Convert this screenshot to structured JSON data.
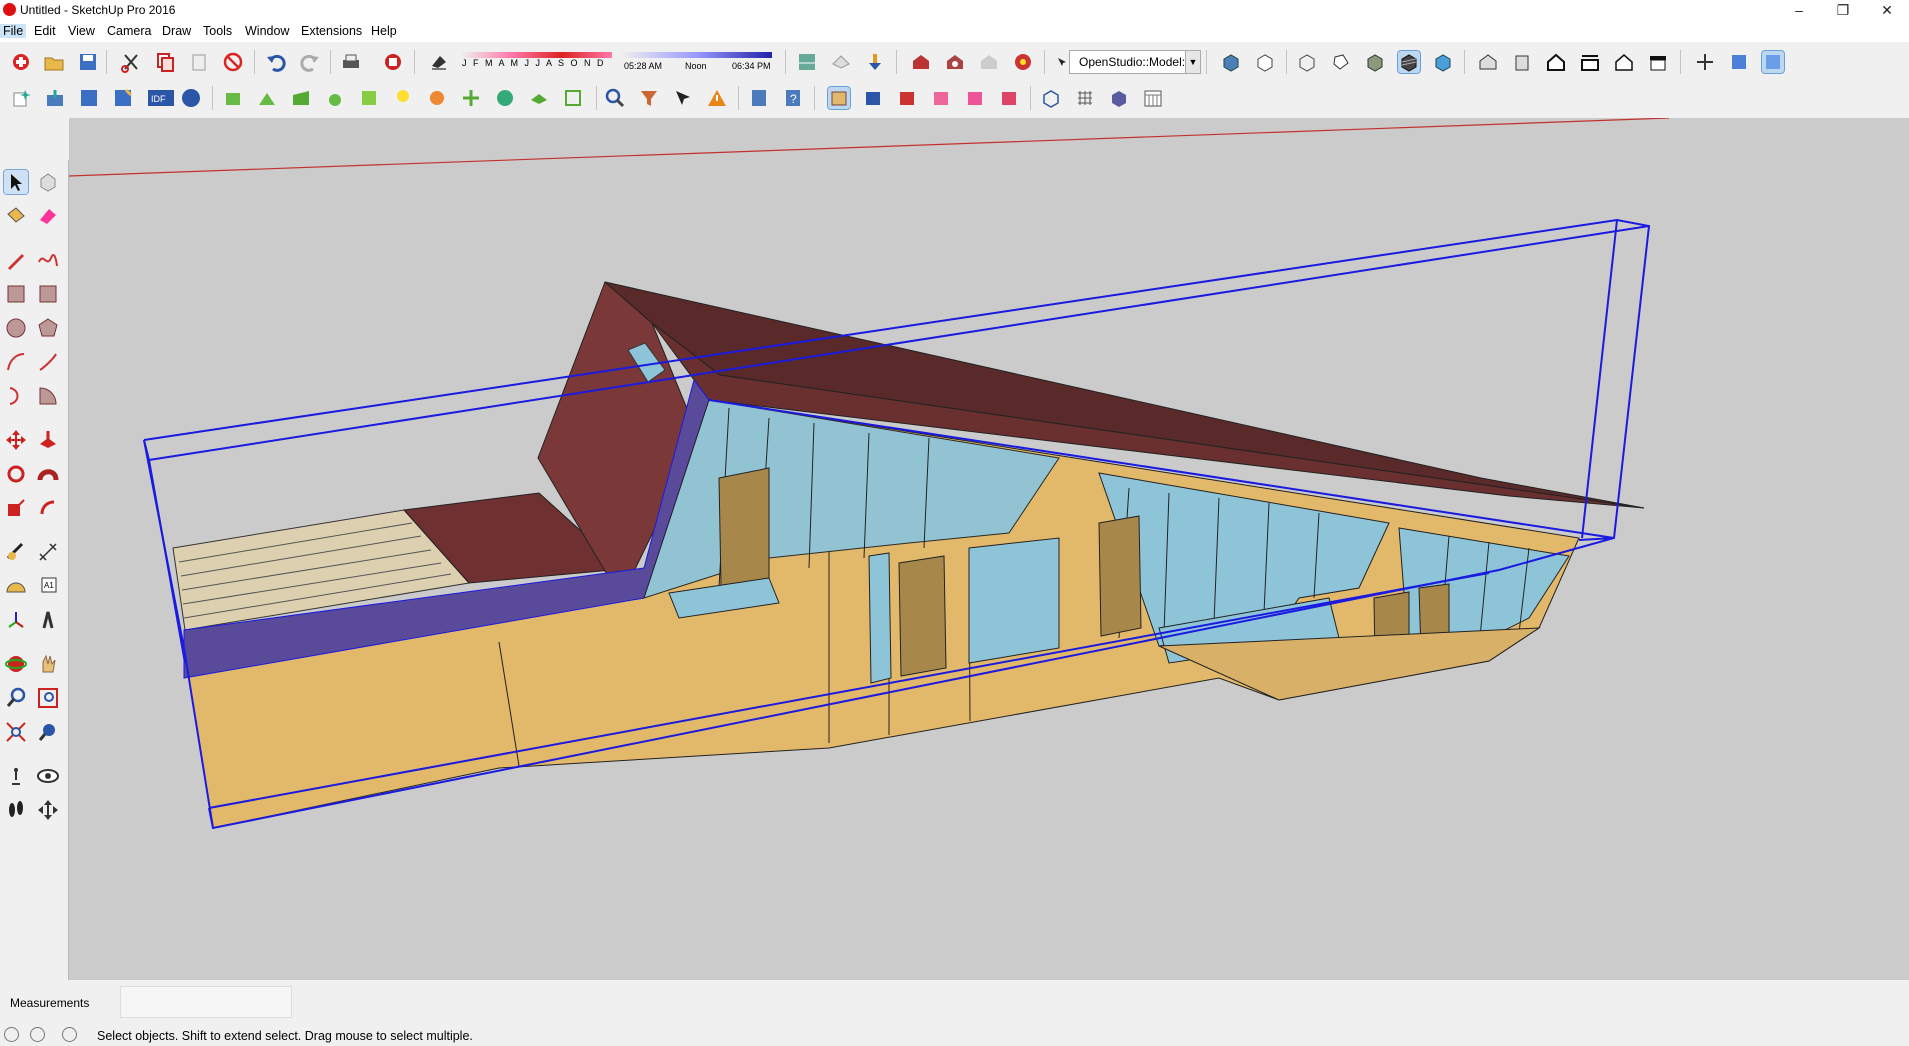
{
  "window": {
    "title": "Untitled - SketchUp Pro 2016",
    "minimize": "–",
    "restore": "❐",
    "close": "✕"
  },
  "menu": [
    "File",
    "Edit",
    "View",
    "Camera",
    "Draw",
    "Tools",
    "Window",
    "Extensions",
    "Help"
  ],
  "shadow": {
    "months": "J F M A M J J A S O N D",
    "sunrise": "05:28 AM",
    "noon": "Noon",
    "sunset": "06:34 PM"
  },
  "openstudio": {
    "dropdown_value": "OpenStudio::Model:"
  },
  "status": {
    "measurements_label": "Measurements",
    "message": "Select objects. Shift to extend select. Drag mouse to select multiple."
  },
  "colors": {
    "viewport_bg": "#cbcbcb",
    "wall": "#e2b86a",
    "roof": "#5a2a2a",
    "glass": "#8ec4d8",
    "selection": "#1a1ae0",
    "axis_red": "#c43030",
    "deck": "#ddd0b0"
  }
}
